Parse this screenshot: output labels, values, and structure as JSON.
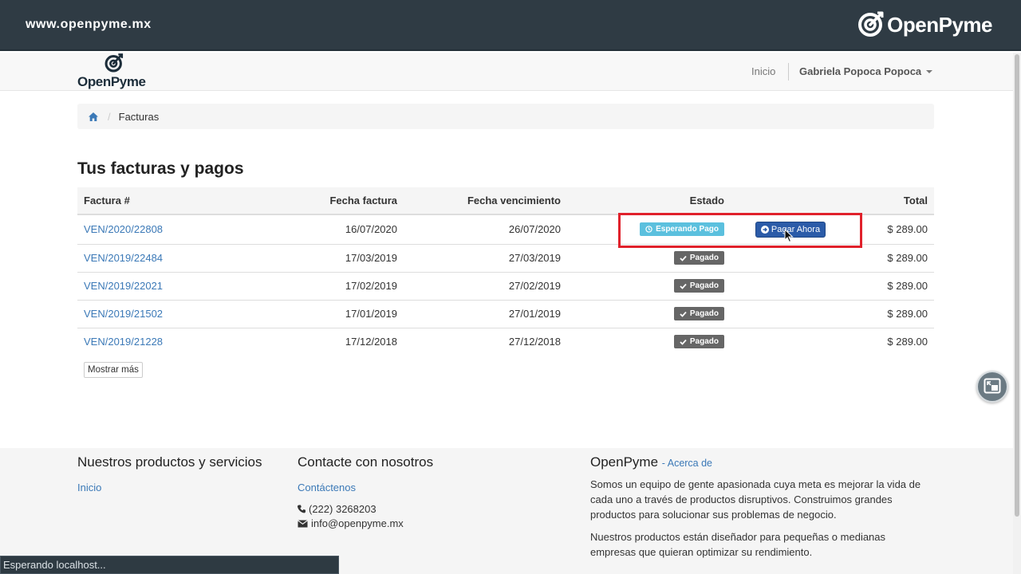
{
  "banner": {
    "url": "www.openpyme.mx",
    "logo_text": "OpenPyme"
  },
  "navbar": {
    "logo_text": "OpenPyme",
    "inicio": "Inicio",
    "user_name": "Gabriela Popoca Popoca"
  },
  "breadcrumb": {
    "home_icon": "home-icon",
    "current": "Facturas"
  },
  "page_title": "Tus facturas y pagos",
  "table": {
    "headers": {
      "numero": "Factura #",
      "fecha": "Fecha factura",
      "vencimiento": "Fecha vencimiento",
      "estado": "Estado",
      "total": "Total"
    },
    "rows": [
      {
        "numero": "VEN/2020/22808",
        "fecha": "16/07/2020",
        "vencimiento": "26/07/2020",
        "estado": "Esperando Pago",
        "accion": "Pagar Ahora",
        "total": "$ 289.00"
      },
      {
        "numero": "VEN/2019/22484",
        "fecha": "17/03/2019",
        "vencimiento": "27/03/2019",
        "estado": "Pagado",
        "total": "$ 289.00"
      },
      {
        "numero": "VEN/2019/22021",
        "fecha": "17/02/2019",
        "vencimiento": "27/02/2019",
        "estado": "Pagado",
        "total": "$ 289.00"
      },
      {
        "numero": "VEN/2019/21502",
        "fecha": "17/01/2019",
        "vencimiento": "27/01/2019",
        "estado": "Pagado",
        "total": "$ 289.00"
      },
      {
        "numero": "VEN/2019/21228",
        "fecha": "17/12/2018",
        "vencimiento": "27/12/2018",
        "estado": "Pagado",
        "total": "$ 289.00"
      }
    ],
    "show_more": "Mostrar más"
  },
  "footer": {
    "products": {
      "heading": "Nuestros productos y servicios",
      "link": "Inicio"
    },
    "contact": {
      "heading": "Contacte con nosotros",
      "link": "Contáctenos",
      "phone": "(222) 3268203",
      "email": "info@openpyme.mx"
    },
    "about": {
      "heading": "OpenPyme",
      "heading_link": "- Acerca de",
      "p1": "Somos un equipo de gente apasionada cuya meta es mejorar la vida de cada uno a través de productos disruptivos. Construimos grandes productos para solucionar sus problemas de negocio.",
      "p2": "Nuestros productos están diseñador para pequeñas o medianas empresas que quieran optimizar su rendimiento."
    }
  },
  "statusbar": "Esperando localhost...",
  "colors": {
    "banner": "#2f3b44",
    "link": "#3b79b7",
    "label_info": "#5bc0de",
    "label_default": "#666666",
    "pay_button": "#2b5ba8",
    "highlight": "#e0212b"
  }
}
